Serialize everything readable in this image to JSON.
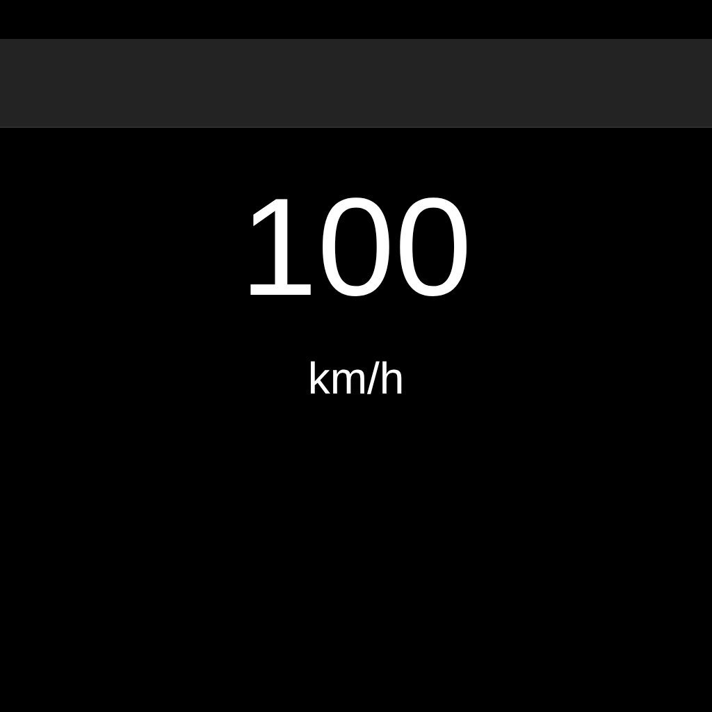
{
  "speed": "100",
  "unit": "km/h"
}
